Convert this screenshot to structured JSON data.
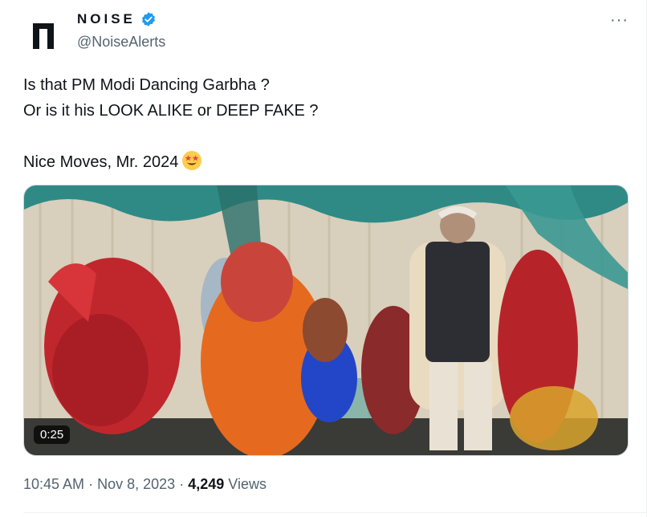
{
  "author": {
    "display_name": "NOISE",
    "handle": "@NoiseAlerts",
    "verified": true,
    "avatar_icon": "noise-logo-icon"
  },
  "tweet": {
    "lines": [
      "Is that PM Modi Dancing Garbha ?",
      "Or is it his LOOK ALIKE or DEEP FAKE ?",
      "Nice Moves, Mr. 2024"
    ],
    "emoji": "star-struck-emoji-icon"
  },
  "media": {
    "type": "video",
    "duration": "0:25"
  },
  "meta": {
    "time": "10:45 AM",
    "separator": "·",
    "date": "Nov 8, 2023",
    "views_count": "4,249",
    "views_label": "Views"
  },
  "more_label": "···",
  "colors": {
    "verified": "#1d9bf0",
    "text": "#0f1419",
    "secondary": "#536471"
  }
}
